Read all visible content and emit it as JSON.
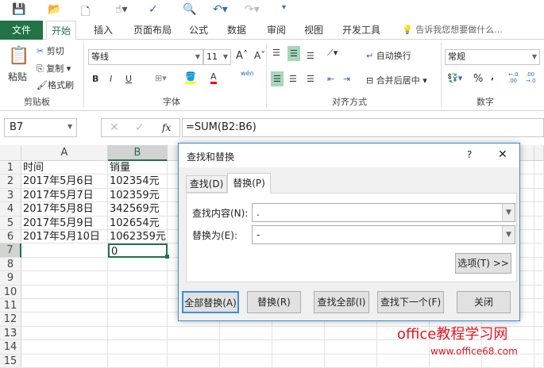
{
  "qat": {
    "icons": [
      "save-icon",
      "open-icon",
      "new-icon",
      "touch-mode-icon",
      "spelling-icon",
      "print-preview-icon",
      "undo-icon",
      "redo-icon",
      "customize-icon"
    ]
  },
  "tabs": [
    "文件",
    "开始",
    "插入",
    "页面布局",
    "公式",
    "数据",
    "审阅",
    "视图",
    "开发工具"
  ],
  "tell_me": "告诉我您想要做什么...",
  "ribbon": {
    "clipboard": {
      "paste": "粘贴",
      "cut": "剪切",
      "copy": "复制",
      "format_painter": "格式刷",
      "label": "剪贴板"
    },
    "font": {
      "name": "等线",
      "size": "11",
      "bold": "B",
      "italic": "I",
      "underline": "U",
      "label": "字体",
      "pinyin": "wén"
    },
    "alignment": {
      "wrap": "自动换行",
      "merge": "合并后居中",
      "label": "对齐方式"
    },
    "number": {
      "format": "常规",
      "percent": "%",
      "comma": ",",
      "inc": "←.0 .00",
      "dec": ".00 →.0",
      "label": "数字"
    },
    "colors": {
      "fill": "#ffff00",
      "font": "#ff0000",
      "accent": "#217346"
    }
  },
  "formula_bar": {
    "name_box": "B7",
    "fx": "fx",
    "formula": "=SUM(B2:B6)"
  },
  "sheet": {
    "columns": [
      "A",
      "B"
    ],
    "rows": [
      "1",
      "2",
      "3",
      "4",
      "5",
      "6",
      "7",
      "8",
      "9",
      "10",
      "11",
      "12",
      "13",
      "14",
      "15"
    ],
    "cells": [
      [
        "时间",
        "销量"
      ],
      [
        "2017年5月6日",
        "102354元"
      ],
      [
        "2017年5月7日",
        "102359元"
      ],
      [
        "2017年5月8日",
        "342569元"
      ],
      [
        "2017年5月9日",
        "102654元"
      ],
      [
        "2017年5月10日",
        "1062359元"
      ],
      [
        "",
        "0"
      ]
    ]
  },
  "dialog": {
    "title": "查找和替换",
    "help": "?",
    "close": "✕",
    "tabs": [
      "查找(D)",
      "替换(P)"
    ],
    "find_label": "查找内容(N):",
    "find_value": ".",
    "replace_label": "替换为(E):",
    "replace_value": "-",
    "options": "选项(T) >>",
    "buttons": [
      "全部替换(A)",
      "替换(R)",
      "查找全部(I)",
      "查找下一个(F)",
      "关闭"
    ]
  },
  "watermark": {
    "line1": "office教程学习网",
    "line2": "www.office68.com"
  }
}
